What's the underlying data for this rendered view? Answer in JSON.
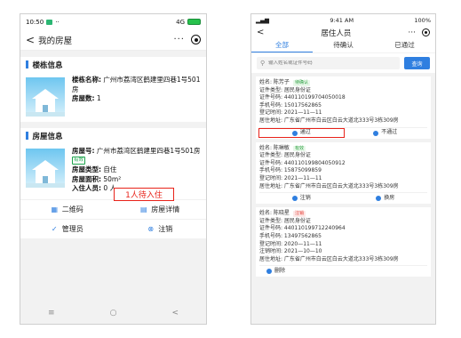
{
  "left_phone": {
    "status": {
      "time": "10:50",
      "signal": "4G"
    },
    "nav": {
      "title": "我的房屋",
      "back": "<",
      "more": "···"
    },
    "building_section": {
      "title": "楼栋信息",
      "name_label": "楼栋名称:",
      "name_value": "广州市荔湾区鹤建里四巷1号501房",
      "count_label": "房屋数:",
      "count_value": "1"
    },
    "house_section": {
      "title": "房屋信息",
      "number_label": "房屋号:",
      "number_value": "广州市荔湾区鹤建里四巷1号501房",
      "number_tag": "有效",
      "type_label": "房屋类型:",
      "type_value": "自住",
      "area_label": "房屋面积:",
      "area_value": "50m²",
      "residents_label": "入住人员:",
      "residents_value": "0 人",
      "pending_callout": "1人待入住"
    },
    "actions": [
      {
        "label": "二维码",
        "icon": "qr-code-icon"
      },
      {
        "label": "房屋详情",
        "icon": "document-icon"
      },
      {
        "label": "管理员",
        "icon": "check-circle-icon"
      },
      {
        "label": "注销",
        "icon": "close-circle-icon"
      }
    ],
    "system_nav": {
      "menu": "≡",
      "home": "○",
      "back": "<"
    }
  },
  "right_phone": {
    "status": {
      "time": "9:41 AM",
      "battery": "100%"
    },
    "nav": {
      "title": "居住人员",
      "back": "<",
      "more": "···"
    },
    "tabs": [
      "全部",
      "待确认",
      "已通过"
    ],
    "search": {
      "placeholder": "输入姓名或证件号码",
      "button": "查询"
    },
    "residents": [
      {
        "name": "姓名: 陈芳子",
        "badge": "待确认",
        "lines": [
          "证件类型: 居民身份证",
          "证件号码: 440110199704050018",
          "手机号码: 15017562865",
          "登记时间: 2021—11—11",
          "居住地址: 广东省广州市白云区白云大道北333号3栋309房"
        ],
        "actions": [
          "通过",
          "不通过"
        ]
      },
      {
        "name": "姓名: 陈琳敏",
        "badge": "有效",
        "lines": [
          "证件类型: 居民身份证",
          "证件号码: 440110199804050912",
          "手机号码: 15875099859",
          "登记时间: 2021—11—11",
          "居住地址: 广东省广州市白云区白云大道北333号3栋309房"
        ],
        "actions": [
          "注销",
          "换房"
        ]
      },
      {
        "name": "姓名: 陈晓星",
        "badge": "注销",
        "lines": [
          "证件类型: 居民身份证",
          "证件号码: 440110199712240964",
          "手机号码: 13497562865",
          "登记时间: 2020—11—11",
          "注销时间: 2021—10—10",
          "居住地址: 广东省广州市白云区白云大道北333号3栋309房"
        ],
        "actions": [
          "删除"
        ]
      }
    ]
  },
  "colors": {
    "accent": "#2f7fe0",
    "highlight": "#e8231a",
    "valid_tag": "#1aa34a"
  }
}
